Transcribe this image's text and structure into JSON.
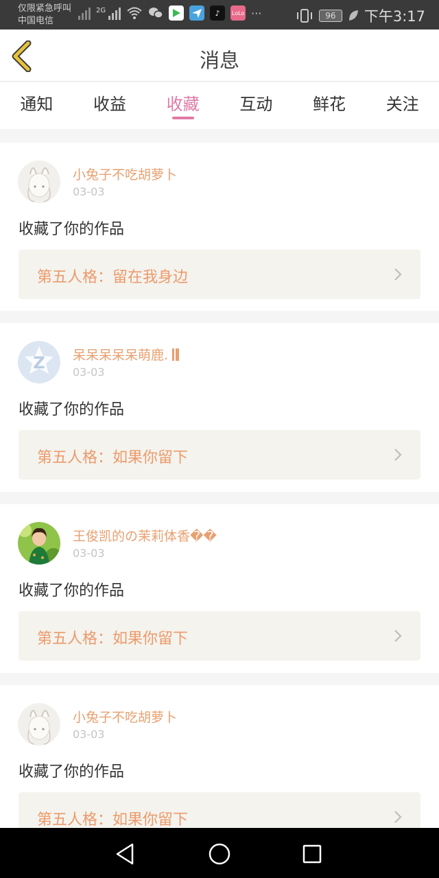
{
  "status_bar": {
    "line1": "仅限紧急呼叫",
    "line2": "中国电信",
    "network": "2G",
    "more": "···",
    "battery": "96",
    "time": "下午3:17",
    "icons": [
      "signal-x-icon",
      "signal-icon",
      "wifi-icon",
      "wechat-icon",
      "play-icon",
      "mail-icon",
      "tiktok-icon",
      "lofter-icon",
      "vibrate-icon",
      "battery-icon",
      "leaf-icon"
    ]
  },
  "header": {
    "title": "消息",
    "back_icon": "back-chevron-icon"
  },
  "tabs": [
    {
      "label": "通知"
    },
    {
      "label": "收益"
    },
    {
      "label": "收藏",
      "active": true
    },
    {
      "label": "互动"
    },
    {
      "label": "鲜花"
    },
    {
      "label": "关注"
    }
  ],
  "cards": [
    {
      "user": "小兔子不吃胡萝卜",
      "date": "03-03",
      "action": "收藏了你的作品",
      "work": "第五人格：留在我身边",
      "avatar": "rabbit-girl-avatar"
    },
    {
      "user": "呆呆呆呆呆萌鹿.",
      "date": "03-03",
      "action": "收藏了你的作品",
      "work": "第五人格：如果你留下",
      "avatar": "default-avatar"
    },
    {
      "user": "王俊凯的の茉莉体香��",
      "date": "03-03",
      "action": "收藏了你的作品",
      "work": "第五人格：如果你留下",
      "avatar": "girl-photo-avatar"
    },
    {
      "user": "小兔子不吃胡萝卜",
      "date": "03-03",
      "action": "收藏了你的作品",
      "work": "第五人格：如果你留下",
      "avatar": "rabbit-girl-avatar"
    }
  ],
  "colors": {
    "accent": "#e07aa7",
    "username": "#e8a070",
    "work_title": "#ec9a6a",
    "back_icon": "#e8c23a"
  },
  "nav": [
    "back-icon",
    "home-icon",
    "recents-icon"
  ]
}
